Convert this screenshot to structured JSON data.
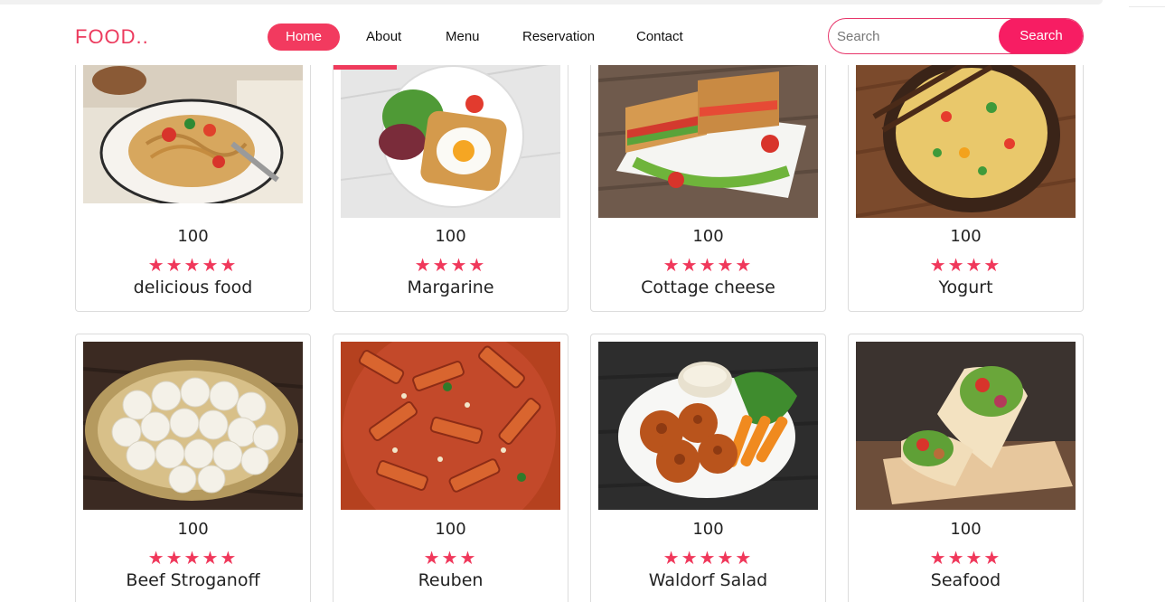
{
  "brand": "FOOD..",
  "nav": {
    "items": [
      {
        "label": "Home",
        "active": true
      },
      {
        "label": "About",
        "active": false
      },
      {
        "label": "Menu",
        "active": false
      },
      {
        "label": "Reservation",
        "active": false
      },
      {
        "label": "Contact",
        "active": false
      }
    ]
  },
  "search": {
    "placeholder": "Search",
    "button_label": "Search"
  },
  "colors": {
    "accent": "#f23a5f",
    "button": "#f71d63",
    "star": "#f0385b"
  },
  "cards": [
    {
      "price": "100",
      "rating": 5,
      "name": "delicious food",
      "image": "spaghetti-plate"
    },
    {
      "price": "100",
      "rating": 4,
      "name": "Margarine",
      "image": "egg-toast-salad"
    },
    {
      "price": "100",
      "rating": 5,
      "name": "Cottage cheese",
      "image": "club-sandwich"
    },
    {
      "price": "100",
      "rating": 4,
      "name": "Yogurt",
      "image": "fried-rice-bowl"
    },
    {
      "price": "100",
      "rating": 5,
      "name": "Beef Stroganoff",
      "image": "sweet-dumplings-platter"
    },
    {
      "price": "100",
      "rating": 3,
      "name": "Reuben",
      "image": "penne-pasta"
    },
    {
      "price": "100",
      "rating": 5,
      "name": "Waldorf Salad",
      "image": "fried-chicken-carrots"
    },
    {
      "price": "100",
      "rating": 4,
      "name": "Seafood",
      "image": "wrap-rolls"
    }
  ]
}
